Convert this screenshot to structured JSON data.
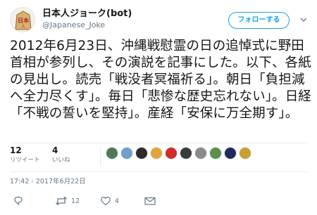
{
  "profile": {
    "display_name": "日本人ジョーク(bot)",
    "handle": "@Japanese_Joke",
    "avatar_icon": "shogi-piece-icon"
  },
  "follow_button": {
    "label": "フォローする"
  },
  "menu": {
    "icon": "chevron-down-icon"
  },
  "tweet": {
    "text": "2012年6月23日、沖縄戦慰霊の日の追悼式に野田首相が参列し、その演説を記事にした。以下、各紙の見出し。読売「戦没者冥福祈る」。朝日「負担減へ全力尽くす」。毎日「悲惨な歴史忘れない」。日経「不戦の誓いを堅持」。産経「安保に万全期す」。"
  },
  "stats": {
    "retweets": {
      "count": "12",
      "label": "リツイート"
    },
    "likes": {
      "count": "4",
      "label": "いいね"
    }
  },
  "timestamp": "17:42 - 2017年6月22日",
  "actions": {
    "reply": {
      "icon": "reply-icon"
    },
    "retweet": {
      "icon": "retweet-icon",
      "count": "12"
    },
    "like": {
      "icon": "heart-icon",
      "count": "4"
    },
    "message": {
      "icon": "envelope-icon"
    }
  },
  "likers": [
    {
      "icon": "liker-avatar-1",
      "color": "#4d7a56"
    },
    {
      "icon": "liker-avatar-2",
      "color": "#6fa0c8"
    },
    {
      "icon": "liker-avatar-3",
      "color": "#2b2b2b"
    },
    {
      "icon": "liker-avatar-4",
      "color": "#e2a33a"
    },
    {
      "icon": "liker-avatar-5",
      "color": "#d12b2b"
    },
    {
      "icon": "liker-avatar-6",
      "color": "#3a3a3a"
    },
    {
      "icon": "liker-avatar-7",
      "color": "#8a8a8a"
    },
    {
      "icon": "liker-avatar-8",
      "color": "#5e8f4a"
    },
    {
      "icon": "liker-avatar-9",
      "color": "#1f2b5c"
    },
    {
      "icon": "liker-avatar-10",
      "color": "#c8a031"
    }
  ],
  "colors": {
    "accent": "#1da1f2",
    "text": "#14171a",
    "muted": "#657786"
  }
}
